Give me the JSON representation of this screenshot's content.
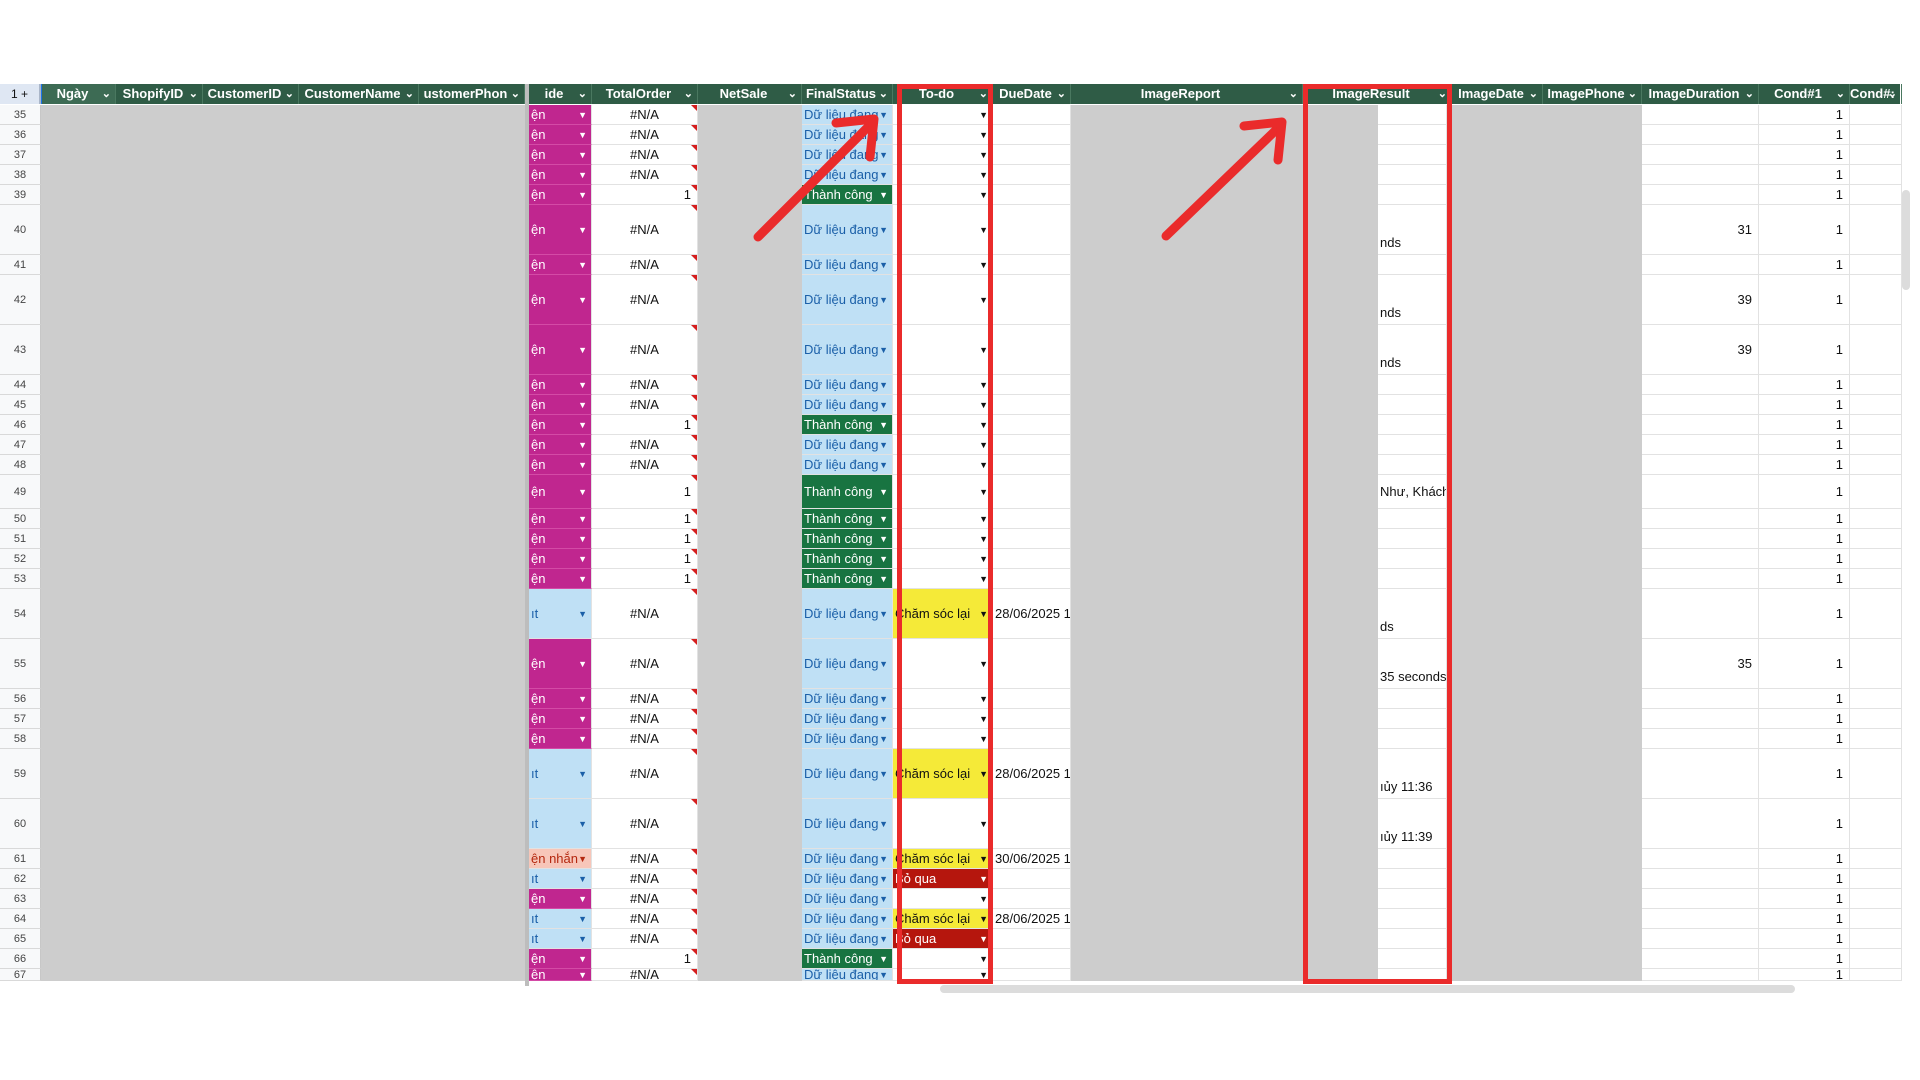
{
  "corner": "1 +",
  "headers": [
    {
      "key": "ngay",
      "label": "Ngày"
    },
    {
      "key": "shopify",
      "label": "ShopifyID"
    },
    {
      "key": "cust",
      "label": "CustomerID"
    },
    {
      "key": "cname",
      "label": "CustomerName"
    },
    {
      "key": "cphone",
      "label": "ustomerPhon"
    },
    {
      "key": "ide",
      "label": "ide"
    },
    {
      "key": "total",
      "label": "TotalOrder"
    },
    {
      "key": "netsale",
      "label": "NetSale"
    },
    {
      "key": "final",
      "label": "FinalStatus"
    },
    {
      "key": "todo",
      "label": "To-do"
    },
    {
      "key": "due",
      "label": "DueDate"
    },
    {
      "key": "imgrep",
      "label": "ImageReport"
    },
    {
      "key": "imgres",
      "label": "ImageResult"
    },
    {
      "key": "imgdate",
      "label": "ImageDate"
    },
    {
      "key": "imgphone",
      "label": "ImagePhone"
    },
    {
      "key": "imgdur",
      "label": "ImageDuration"
    },
    {
      "key": "cond1",
      "label": "Cond#1"
    },
    {
      "key": "cond2",
      "label": "Cond#:"
    }
  ],
  "rows": [
    {
      "n": "35",
      "h": "s",
      "ide": "ện",
      "ideColor": "pink",
      "total": "#N/A",
      "final": "Dữ liệu đang",
      "finalColor": "blue",
      "todo": "",
      "due": "",
      "res": "",
      "dur": "",
      "cond": "1"
    },
    {
      "n": "36",
      "h": "s",
      "ide": "ện",
      "ideColor": "pink",
      "total": "#N/A",
      "final": "Dữ liệu đang",
      "finalColor": "blue",
      "todo": "",
      "due": "",
      "res": "",
      "dur": "",
      "cond": "1"
    },
    {
      "n": "37",
      "h": "s",
      "ide": "ện",
      "ideColor": "pink",
      "total": "#N/A",
      "final": "Dữ liệu đang",
      "finalColor": "blue",
      "todo": "",
      "due": "",
      "res": "",
      "dur": "",
      "cond": "1"
    },
    {
      "n": "38",
      "h": "s",
      "ide": "ện",
      "ideColor": "pink",
      "total": "#N/A",
      "final": "Dữ liệu đang",
      "finalColor": "blue",
      "todo": "",
      "due": "",
      "res": "",
      "dur": "",
      "cond": "1"
    },
    {
      "n": "39",
      "h": "s",
      "ide": "ện",
      "ideColor": "pink",
      "total": "1",
      "final": "Thành công",
      "finalColor": "green",
      "todo": "",
      "due": "",
      "res": "",
      "dur": "",
      "cond": "1"
    },
    {
      "n": "40",
      "h": "l",
      "ide": "ện",
      "ideColor": "pink",
      "total": "#N/A",
      "final": "Dữ liệu đang",
      "finalColor": "blue",
      "todo": "",
      "due": "",
      "res": "nds",
      "dur": "31",
      "cond": "1"
    },
    {
      "n": "41",
      "h": "s",
      "ide": "ện",
      "ideColor": "pink",
      "total": "#N/A",
      "final": "Dữ liệu đang",
      "finalColor": "blue",
      "todo": "",
      "due": "",
      "res": "",
      "dur": "",
      "cond": "1"
    },
    {
      "n": "42",
      "h": "l",
      "ide": "ện",
      "ideColor": "pink",
      "total": "#N/A",
      "final": "Dữ liệu đang",
      "finalColor": "blue",
      "todo": "",
      "due": "",
      "res": "nds",
      "dur": "39",
      "cond": "1"
    },
    {
      "n": "43",
      "h": "l",
      "ide": "ện",
      "ideColor": "pink",
      "total": "#N/A",
      "final": "Dữ liệu đang",
      "finalColor": "blue",
      "todo": "",
      "due": "",
      "res": "nds",
      "dur": "39",
      "cond": "1"
    },
    {
      "n": "44",
      "h": "s",
      "ide": "ện",
      "ideColor": "pink",
      "total": "#N/A",
      "final": "Dữ liệu đang",
      "finalColor": "blue",
      "todo": "",
      "due": "",
      "res": "",
      "dur": "",
      "cond": "1"
    },
    {
      "n": "45",
      "h": "s",
      "ide": "ện",
      "ideColor": "pink",
      "total": "#N/A",
      "final": "Dữ liệu đang",
      "finalColor": "blue",
      "todo": "",
      "due": "",
      "res": "",
      "dur": "",
      "cond": "1"
    },
    {
      "n": "46",
      "h": "s",
      "ide": "ện",
      "ideColor": "pink",
      "total": "1",
      "final": "Thành công",
      "finalColor": "green",
      "todo": "",
      "due": "",
      "res": "",
      "dur": "",
      "cond": "1"
    },
    {
      "n": "47",
      "h": "s",
      "ide": "ện",
      "ideColor": "pink",
      "total": "#N/A",
      "final": "Dữ liệu đang",
      "finalColor": "blue",
      "todo": "",
      "due": "",
      "res": "",
      "dur": "",
      "cond": "1"
    },
    {
      "n": "48",
      "h": "s",
      "ide": "ện",
      "ideColor": "pink",
      "total": "#N/A",
      "final": "Dữ liệu đang",
      "finalColor": "blue",
      "todo": "",
      "due": "",
      "res": "",
      "dur": "",
      "cond": "1"
    },
    {
      "n": "49",
      "h": "m",
      "ide": "ện",
      "ideColor": "pink",
      "total": "1",
      "final": "Thành công",
      "finalColor": "green",
      "todo": "",
      "due": "",
      "res": "Như, Khách",
      "dur": "",
      "cond": "1"
    },
    {
      "n": "50",
      "h": "s",
      "ide": "ện",
      "ideColor": "pink",
      "total": "1",
      "final": "Thành công",
      "finalColor": "green",
      "todo": "",
      "due": "",
      "res": "",
      "dur": "",
      "cond": "1"
    },
    {
      "n": "51",
      "h": "s",
      "ide": "ện",
      "ideColor": "pink",
      "total": "1",
      "final": "Thành công",
      "finalColor": "green",
      "todo": "",
      "due": "",
      "res": "",
      "dur": "",
      "cond": "1"
    },
    {
      "n": "52",
      "h": "s",
      "ide": "ện",
      "ideColor": "pink",
      "total": "1",
      "final": "Thành công",
      "finalColor": "green",
      "todo": "",
      "due": "",
      "res": "",
      "dur": "",
      "cond": "1"
    },
    {
      "n": "53",
      "h": "s",
      "ide": "ện",
      "ideColor": "pink",
      "total": "1",
      "final": "Thành công",
      "finalColor": "green",
      "todo": "",
      "due": "",
      "res": "",
      "dur": "",
      "cond": "1"
    },
    {
      "n": "54",
      "h": "l",
      "ide": "ıt",
      "ideColor": "lblue",
      "total": "#N/A",
      "final": "Dữ liệu đang",
      "finalColor": "blue",
      "todo": "Chăm sóc lại",
      "todoColor": "yellow",
      "due": "28/06/2025 1",
      "res": "ds",
      "dur": "",
      "cond": "1"
    },
    {
      "n": "55",
      "h": "l",
      "ide": "ện",
      "ideColor": "pink",
      "total": "#N/A",
      "final": "Dữ liệu đang",
      "finalColor": "blue",
      "todo": "",
      "due": "",
      "res": "35 seconds",
      "dur": "35",
      "cond": "1"
    },
    {
      "n": "56",
      "h": "s",
      "ide": "ện",
      "ideColor": "pink",
      "total": "#N/A",
      "final": "Dữ liệu đang",
      "finalColor": "blue",
      "todo": "",
      "due": "",
      "res": "",
      "dur": "",
      "cond": "1"
    },
    {
      "n": "57",
      "h": "s",
      "ide": "ện",
      "ideColor": "pink",
      "total": "#N/A",
      "final": "Dữ liệu đang",
      "finalColor": "blue",
      "todo": "",
      "due": "",
      "res": "",
      "dur": "",
      "cond": "1"
    },
    {
      "n": "58",
      "h": "s",
      "ide": "ện",
      "ideColor": "pink",
      "total": "#N/A",
      "final": "Dữ liệu đang",
      "finalColor": "blue",
      "todo": "",
      "due": "",
      "res": "",
      "dur": "",
      "cond": "1"
    },
    {
      "n": "59",
      "h": "l",
      "ide": "ıt",
      "ideColor": "lblue",
      "total": "#N/A",
      "final": "Dữ liệu đang",
      "finalColor": "blue",
      "todo": "Chăm sóc lại",
      "todoColor": "yellow",
      "due": "28/06/2025 1",
      "res": "ıủy 11:36",
      "dur": "",
      "cond": "1"
    },
    {
      "n": "60",
      "h": "l",
      "ide": "ıt",
      "ideColor": "lblue",
      "total": "#N/A",
      "final": "Dữ liệu đang",
      "finalColor": "blue",
      "todo": "",
      "due": "",
      "res": "ıủy 11:39",
      "dur": "",
      "cond": "1"
    },
    {
      "n": "61",
      "h": "s",
      "ide": "ện nhắn",
      "ideColor": "salmon",
      "total": "#N/A",
      "final": "Dữ liệu đang",
      "finalColor": "blue",
      "todo": "Chăm sóc lại",
      "todoColor": "yellow",
      "due": "30/06/2025 1",
      "res": "",
      "dur": "",
      "cond": "1"
    },
    {
      "n": "62",
      "h": "s",
      "ide": "ıt",
      "ideColor": "lblue",
      "total": "#N/A",
      "final": "Dữ liệu đang",
      "finalColor": "blue",
      "todo": "Bỏ qua",
      "todoColor": "red",
      "due": "",
      "res": "",
      "dur": "",
      "cond": "1"
    },
    {
      "n": "63",
      "h": "s",
      "ide": "ện",
      "ideColor": "pink",
      "total": "#N/A",
      "final": "Dữ liệu đang",
      "finalColor": "blue",
      "todo": "",
      "due": "",
      "res": "",
      "dur": "",
      "cond": "1"
    },
    {
      "n": "64",
      "h": "s",
      "ide": "ıt",
      "ideColor": "lblue",
      "total": "#N/A",
      "final": "Dữ liệu đang",
      "finalColor": "blue",
      "todo": "Chăm sóc lại",
      "todoColor": "yellow",
      "due": "28/06/2025 1",
      "res": "",
      "dur": "",
      "cond": "1"
    },
    {
      "n": "65",
      "h": "s",
      "ide": "ıt",
      "ideColor": "lblue",
      "total": "#N/A",
      "final": "Dữ liệu đang",
      "finalColor": "blue",
      "todo": "Bỏ qua",
      "todoColor": "red",
      "due": "",
      "res": "",
      "dur": "",
      "cond": "1"
    },
    {
      "n": "66",
      "h": "s",
      "ide": "ện",
      "ideColor": "pink",
      "total": "1",
      "final": "Thành công",
      "finalColor": "green",
      "todo": "",
      "due": "",
      "res": "",
      "dur": "",
      "cond": "1"
    },
    {
      "n": "67",
      "h": "t",
      "ide": "ện",
      "ideColor": "pink",
      "total": "#N/A",
      "final": "Dữ liệu đang",
      "finalColor": "blue",
      "todo": "",
      "due": "",
      "res": "",
      "dur": "",
      "cond": "1"
    }
  ],
  "colors": {
    "header_bg": "#2f5c46",
    "pink": "#c0268f",
    "light_blue": "#bfe0f5",
    "salmon": "#f7c6b9",
    "status_green": "#187441",
    "todo_yellow": "#f5ea38",
    "todo_red": "#b5160d",
    "annotation_red": "#ea2b2b",
    "redacted_gray": "#cdcdcd"
  },
  "annotations": {
    "highlighted_columns": [
      "To-do",
      "ImageResult"
    ],
    "icons": [
      "arrow-annotation-icon",
      "arrow-annotation-icon"
    ]
  }
}
